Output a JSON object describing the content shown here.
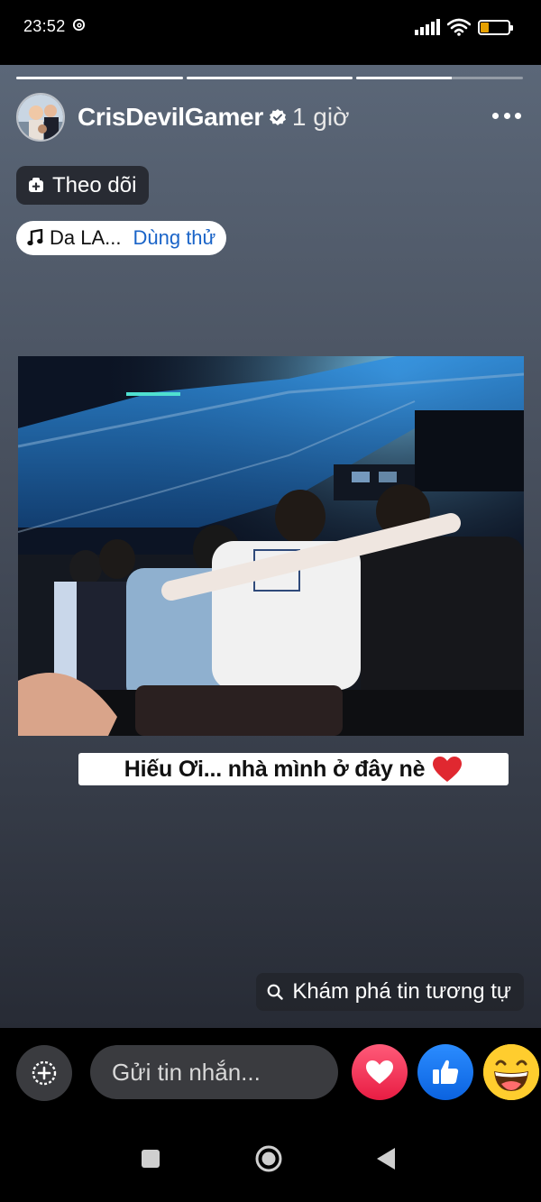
{
  "status_bar": {
    "time": "23:52",
    "battery": "29"
  },
  "story": {
    "progress": [
      1.0,
      1.0,
      0.57
    ],
    "author": {
      "name": "CrisDevilGamer",
      "time": "1 giờ"
    },
    "follow_label": "Theo dõi",
    "music": {
      "title": "Da LA...",
      "try_label": "Dùng thử"
    },
    "caption": "Hiếu Ơi... nhà mình ở đây nè",
    "explore_label": "Khám phá tin tương tự"
  },
  "reply_bar": {
    "placeholder": "Gửi tin nhắn..."
  },
  "icons": {
    "follow": "messenger-plus-icon",
    "music": "music-note-icon",
    "search": "search-icon",
    "add": "add-circle-icon",
    "love": "love-reaction-icon",
    "like": "like-reaction-icon",
    "haha": "haha-reaction-icon"
  },
  "colors": {
    "link_blue": "#1a64c8",
    "love_red": "#e81d43",
    "like_blue": "#0b63e0",
    "haha_yellow": "#ffcd2e"
  }
}
